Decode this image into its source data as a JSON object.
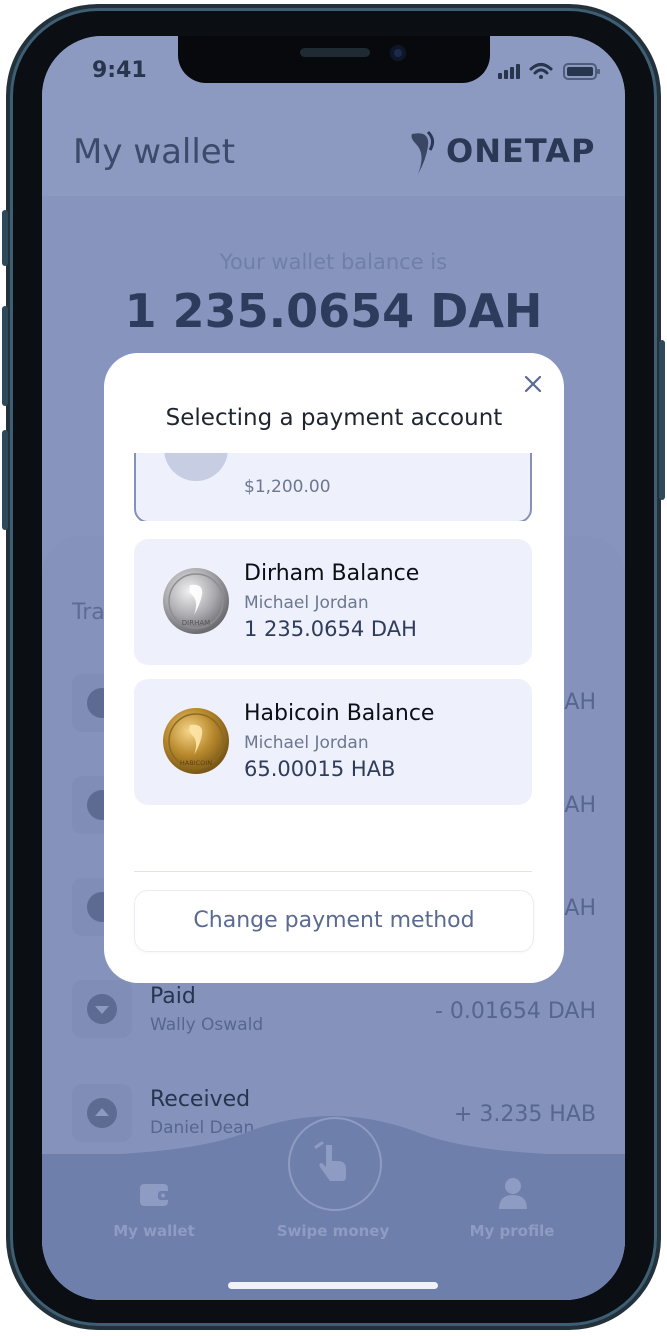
{
  "status_bar": {
    "time": "9:41"
  },
  "header": {
    "title": "My wallet",
    "brand": "ONETAP"
  },
  "wallet": {
    "balance_label": "Your wallet balance is",
    "balance_value": "1 235.0654  DAH"
  },
  "transactions": {
    "title_partial": "Tra",
    "items": [
      {
        "amount_partial": "AH",
        "direction": "down"
      },
      {
        "amount_partial": "AH",
        "direction": "up"
      },
      {
        "amount_partial": "AH",
        "direction": "down"
      },
      {
        "name": "Paid",
        "party": "Wally Oswald",
        "amount": "- 0.01654  DAH",
        "direction": "down"
      },
      {
        "name": "Received",
        "party": "Daniel Dean",
        "amount": "+ 3.235  HAB",
        "direction": "up"
      }
    ]
  },
  "bottom_nav": {
    "items": [
      {
        "label": "My wallet",
        "icon": "wallet-icon"
      },
      {
        "label": "Swipe money",
        "icon": "swipe-hand-icon"
      },
      {
        "label": "My profile",
        "icon": "profile-icon"
      }
    ]
  },
  "modal": {
    "title": "Selecting a payment account",
    "partial_account": {
      "amount": "$1,200.00"
    },
    "accounts": [
      {
        "name": "Dirham Balance",
        "holder": "Michael Jordan",
        "amount": "1 235.0654  DAH",
        "coin": "dirham-coin-icon",
        "coin_text": "DIRHAM",
        "coin_color": "#a9a9ad"
      },
      {
        "name": "Habicoin Balance",
        "holder": "Michael Jordan",
        "amount": "65.00015  HAB",
        "coin": "habicoin-coin-icon",
        "coin_text": "HABICOIN",
        "coin_color": "#b98a2e"
      }
    ],
    "change_button": "Change payment method"
  },
  "colors": {
    "accent": "#2d3b5c",
    "modal_card": "#eef1fb",
    "overlay": "#8795be"
  }
}
